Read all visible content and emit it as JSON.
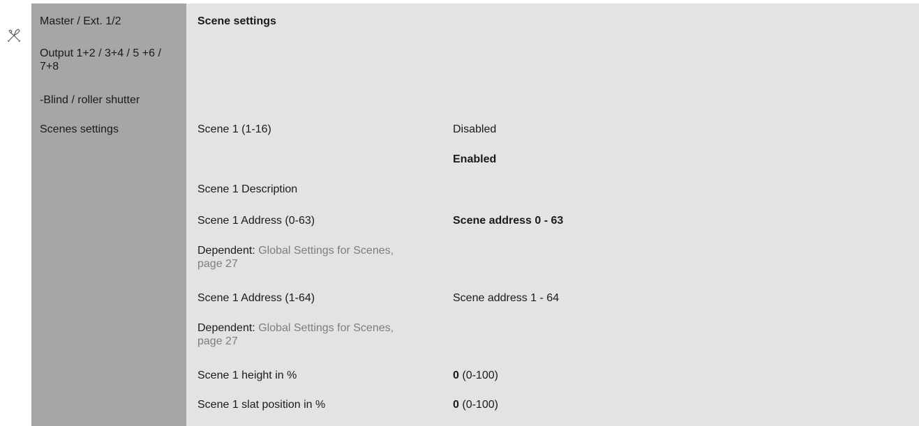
{
  "sidebar": {
    "items": [
      {
        "label": "Master / Ext. 1/2"
      },
      {
        "label": "Output 1+2 / 3+4 / 5 +6 / 7+8"
      },
      {
        "label": "-Blind / roller shutter"
      },
      {
        "label": "Scenes settings"
      }
    ]
  },
  "header": {
    "title": "Scene settings"
  },
  "rows": {
    "scene": {
      "label": "Scene 1 (1-16)",
      "value_disabled": "Disabled",
      "value_enabled": "Enabled"
    },
    "description": {
      "label": "Scene 1 Description"
    },
    "address_0_63": {
      "label": "Scene 1 Address (0-63)",
      "value": "Scene address 0 - 63"
    },
    "dependent_1": {
      "prefix": "Dependent:",
      "link": "Global Settings for Scenes, page 27"
    },
    "address_1_64": {
      "label": "Scene 1 Address (1-64)",
      "value": "Scene address 1 - 64"
    },
    "dependent_2": {
      "prefix": "Dependent:",
      "link": "Global Settings for Scenes, page 27"
    },
    "height": {
      "label": "Scene 1 height in %",
      "value": "0",
      "range": "(0-100)"
    },
    "slat": {
      "label": "Scene 1 slat position in %",
      "value": "0",
      "range": "(0-100)"
    }
  },
  "icons": {
    "tool": "tools-icon"
  },
  "colors": {
    "sidebar_bg": "#a6a6a6",
    "content_bg": "#e3e3e3",
    "link": "#7d7d7d"
  }
}
